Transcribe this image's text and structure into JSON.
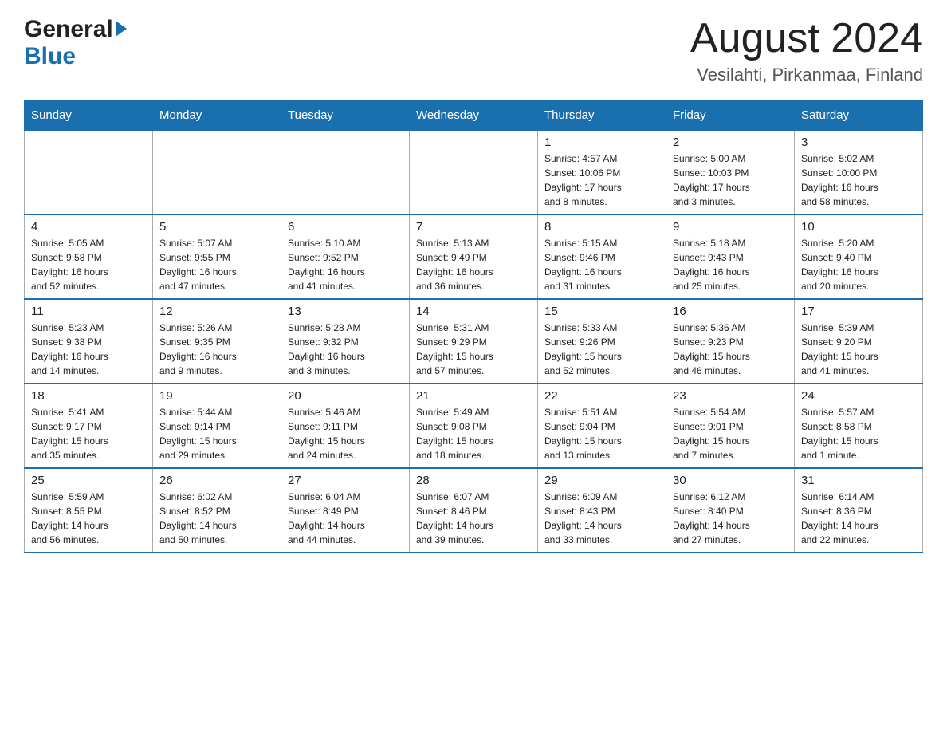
{
  "header": {
    "title": "August 2024",
    "subtitle": "Vesilahti, Pirkanmaa, Finland",
    "logo_general": "General",
    "logo_blue": "Blue"
  },
  "days_of_week": [
    "Sunday",
    "Monday",
    "Tuesday",
    "Wednesday",
    "Thursday",
    "Friday",
    "Saturday"
  ],
  "weeks": [
    [
      {
        "day": "",
        "info": ""
      },
      {
        "day": "",
        "info": ""
      },
      {
        "day": "",
        "info": ""
      },
      {
        "day": "",
        "info": ""
      },
      {
        "day": "1",
        "info": "Sunrise: 4:57 AM\nSunset: 10:06 PM\nDaylight: 17 hours\nand 8 minutes."
      },
      {
        "day": "2",
        "info": "Sunrise: 5:00 AM\nSunset: 10:03 PM\nDaylight: 17 hours\nand 3 minutes."
      },
      {
        "day": "3",
        "info": "Sunrise: 5:02 AM\nSunset: 10:00 PM\nDaylight: 16 hours\nand 58 minutes."
      }
    ],
    [
      {
        "day": "4",
        "info": "Sunrise: 5:05 AM\nSunset: 9:58 PM\nDaylight: 16 hours\nand 52 minutes."
      },
      {
        "day": "5",
        "info": "Sunrise: 5:07 AM\nSunset: 9:55 PM\nDaylight: 16 hours\nand 47 minutes."
      },
      {
        "day": "6",
        "info": "Sunrise: 5:10 AM\nSunset: 9:52 PM\nDaylight: 16 hours\nand 41 minutes."
      },
      {
        "day": "7",
        "info": "Sunrise: 5:13 AM\nSunset: 9:49 PM\nDaylight: 16 hours\nand 36 minutes."
      },
      {
        "day": "8",
        "info": "Sunrise: 5:15 AM\nSunset: 9:46 PM\nDaylight: 16 hours\nand 31 minutes."
      },
      {
        "day": "9",
        "info": "Sunrise: 5:18 AM\nSunset: 9:43 PM\nDaylight: 16 hours\nand 25 minutes."
      },
      {
        "day": "10",
        "info": "Sunrise: 5:20 AM\nSunset: 9:40 PM\nDaylight: 16 hours\nand 20 minutes."
      }
    ],
    [
      {
        "day": "11",
        "info": "Sunrise: 5:23 AM\nSunset: 9:38 PM\nDaylight: 16 hours\nand 14 minutes."
      },
      {
        "day": "12",
        "info": "Sunrise: 5:26 AM\nSunset: 9:35 PM\nDaylight: 16 hours\nand 9 minutes."
      },
      {
        "day": "13",
        "info": "Sunrise: 5:28 AM\nSunset: 9:32 PM\nDaylight: 16 hours\nand 3 minutes."
      },
      {
        "day": "14",
        "info": "Sunrise: 5:31 AM\nSunset: 9:29 PM\nDaylight: 15 hours\nand 57 minutes."
      },
      {
        "day": "15",
        "info": "Sunrise: 5:33 AM\nSunset: 9:26 PM\nDaylight: 15 hours\nand 52 minutes."
      },
      {
        "day": "16",
        "info": "Sunrise: 5:36 AM\nSunset: 9:23 PM\nDaylight: 15 hours\nand 46 minutes."
      },
      {
        "day": "17",
        "info": "Sunrise: 5:39 AM\nSunset: 9:20 PM\nDaylight: 15 hours\nand 41 minutes."
      }
    ],
    [
      {
        "day": "18",
        "info": "Sunrise: 5:41 AM\nSunset: 9:17 PM\nDaylight: 15 hours\nand 35 minutes."
      },
      {
        "day": "19",
        "info": "Sunrise: 5:44 AM\nSunset: 9:14 PM\nDaylight: 15 hours\nand 29 minutes."
      },
      {
        "day": "20",
        "info": "Sunrise: 5:46 AM\nSunset: 9:11 PM\nDaylight: 15 hours\nand 24 minutes."
      },
      {
        "day": "21",
        "info": "Sunrise: 5:49 AM\nSunset: 9:08 PM\nDaylight: 15 hours\nand 18 minutes."
      },
      {
        "day": "22",
        "info": "Sunrise: 5:51 AM\nSunset: 9:04 PM\nDaylight: 15 hours\nand 13 minutes."
      },
      {
        "day": "23",
        "info": "Sunrise: 5:54 AM\nSunset: 9:01 PM\nDaylight: 15 hours\nand 7 minutes."
      },
      {
        "day": "24",
        "info": "Sunrise: 5:57 AM\nSunset: 8:58 PM\nDaylight: 15 hours\nand 1 minute."
      }
    ],
    [
      {
        "day": "25",
        "info": "Sunrise: 5:59 AM\nSunset: 8:55 PM\nDaylight: 14 hours\nand 56 minutes."
      },
      {
        "day": "26",
        "info": "Sunrise: 6:02 AM\nSunset: 8:52 PM\nDaylight: 14 hours\nand 50 minutes."
      },
      {
        "day": "27",
        "info": "Sunrise: 6:04 AM\nSunset: 8:49 PM\nDaylight: 14 hours\nand 44 minutes."
      },
      {
        "day": "28",
        "info": "Sunrise: 6:07 AM\nSunset: 8:46 PM\nDaylight: 14 hours\nand 39 minutes."
      },
      {
        "day": "29",
        "info": "Sunrise: 6:09 AM\nSunset: 8:43 PM\nDaylight: 14 hours\nand 33 minutes."
      },
      {
        "day": "30",
        "info": "Sunrise: 6:12 AM\nSunset: 8:40 PM\nDaylight: 14 hours\nand 27 minutes."
      },
      {
        "day": "31",
        "info": "Sunrise: 6:14 AM\nSunset: 8:36 PM\nDaylight: 14 hours\nand 22 minutes."
      }
    ]
  ]
}
